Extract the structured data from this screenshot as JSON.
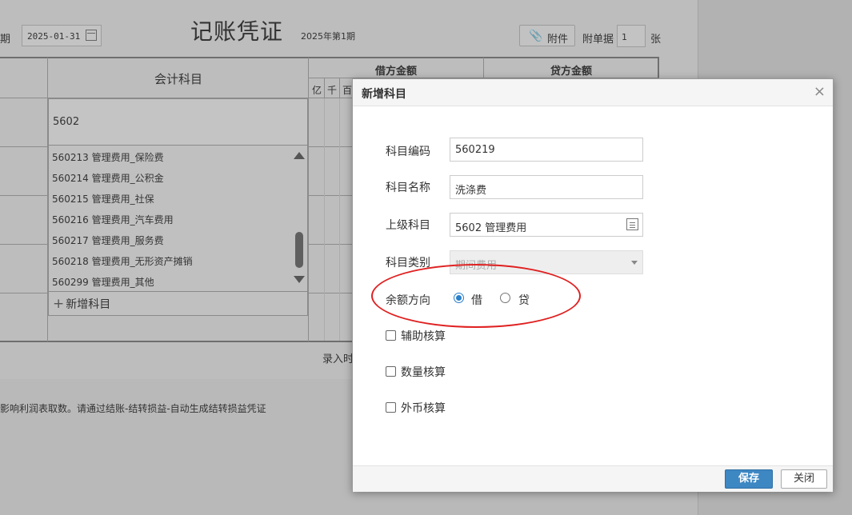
{
  "voucher": {
    "date_label": "日期",
    "date_value": "2025-01-31",
    "title": "记账凭证",
    "period": "2025年第1期",
    "attach_label": "附件",
    "docs_label": "附单据",
    "docs_count": "1",
    "docs_unit": "张",
    "table": {
      "subject_header": "会计科目",
      "debit_header": "借方金额",
      "credit_header": "贷方金额",
      "digit_headers": [
        "亿",
        "千",
        "百"
      ]
    },
    "subject_input_value": "5602",
    "dropdown_items": [
      "560213 管理费用_保险费",
      "560214 管理费用_公积金",
      "560215 管理费用_社保",
      "560216 管理费用_汽车费用",
      "560217 管理费用_服务费",
      "560218 管理费用_无形资产摊销",
      "560299 管理费用_其他"
    ],
    "add_subject_label": "新增科目",
    "entry_time_label": "录入时",
    "notice": "影响利润表取数。请通过结账-结转损益-自动生成结转损益凭证"
  },
  "modal": {
    "title": "新增科目",
    "code_label": "科目编码",
    "code_value": "560219",
    "name_label": "科目名称",
    "name_value": "洗涤费",
    "parent_label": "上级科目",
    "parent_value": "5602 管理费用",
    "type_label": "科目类别",
    "type_value": "期间费用",
    "direction_label": "余额方向",
    "direction_options": [
      {
        "label": "借",
        "selected": true
      },
      {
        "label": "贷",
        "selected": false
      }
    ],
    "aux_label": "辅助核算",
    "qty_label": "数量核算",
    "fx_label": "外币核算",
    "save_label": "保存",
    "close_label": "关闭"
  },
  "colors": {
    "primary": "#3d87c3",
    "highlight": "#e02020"
  }
}
